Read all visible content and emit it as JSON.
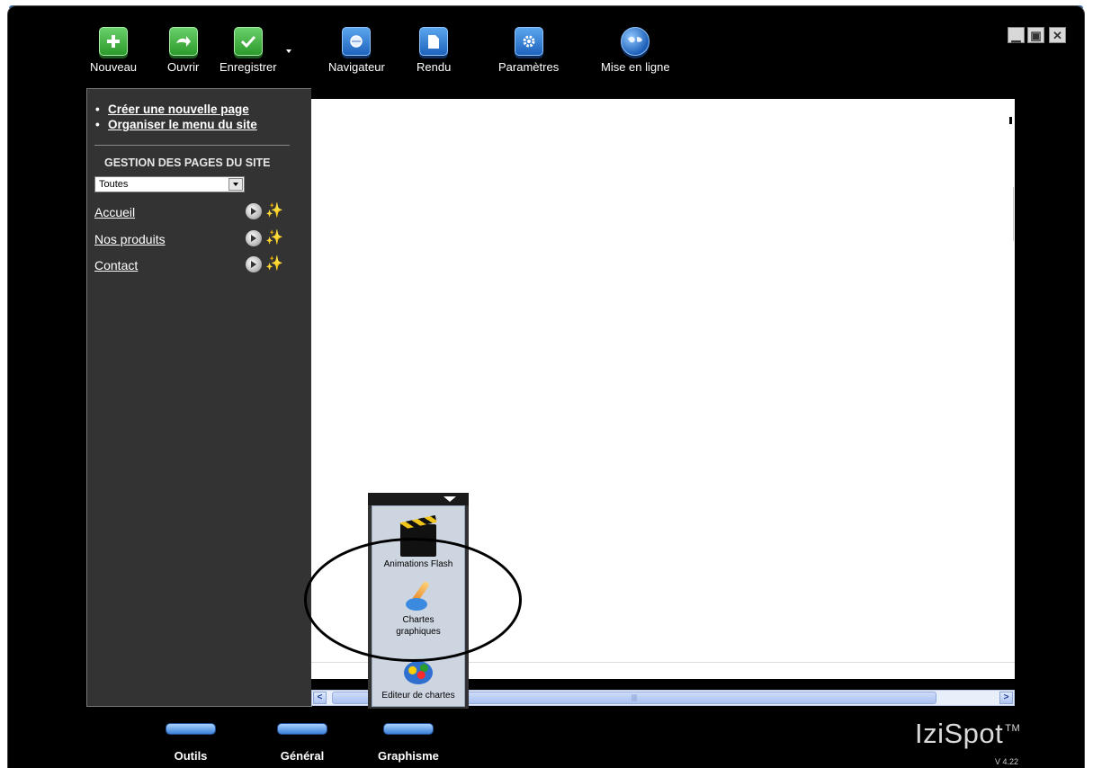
{
  "toolbar": {
    "items": [
      {
        "label": "Nouveau",
        "icon": "plus-icon"
      },
      {
        "label": "Ouvrir",
        "icon": "open-arrow-icon"
      },
      {
        "label": "Enregistrer",
        "icon": "check-icon"
      },
      {
        "label": "Navigateur",
        "icon": "browser-icon"
      },
      {
        "label": "Rendu",
        "icon": "page-icon"
      },
      {
        "label": "Paramètres",
        "icon": "gear-icon"
      },
      {
        "label": "Mise en ligne",
        "icon": "globe-icon"
      }
    ]
  },
  "sidebar": {
    "links": [
      "Créer une nouvelle page",
      "Organiser le menu du site"
    ],
    "section_title": "GESTION DES PAGES DU SITE",
    "filter_value": "Toutes",
    "pages": [
      "Accueil",
      "Nos produits",
      "Contact"
    ]
  },
  "popup": {
    "items": [
      "Animations Flash",
      "Chartes graphiques",
      "Editeur de chartes"
    ]
  },
  "bottom_tabs": [
    "Outils",
    "Général",
    "Graphisme"
  ],
  "brand": {
    "name": "IziSpot",
    "tm": "TM",
    "version": "V 4.22"
  },
  "colors": {
    "frame": "#000000",
    "panel": "#333333",
    "accent": "#2a72d6"
  }
}
